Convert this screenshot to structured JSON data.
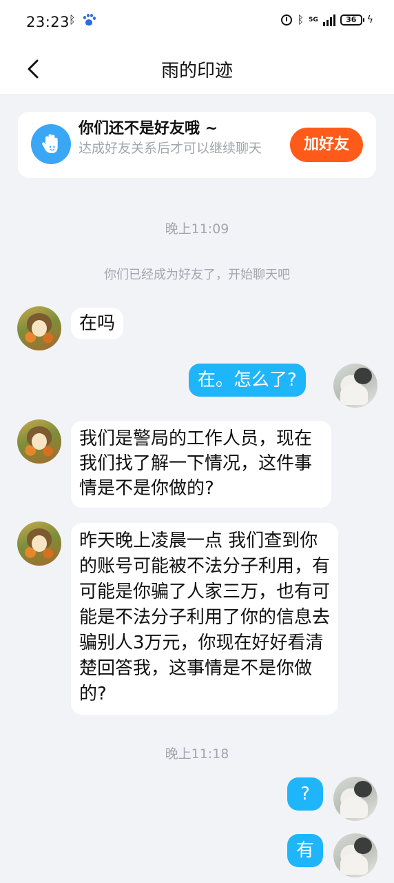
{
  "status_bar": {
    "time": "23:23",
    "network": "5G",
    "battery": "36"
  },
  "header": {
    "title": "雨的印迹"
  },
  "friend_notice": {
    "title": "你们还不是好友哦 ~",
    "description": "达成好友关系后才可以继续聊天",
    "add_button": "加好友"
  },
  "chat": {
    "timestamp_1": "晚上11:09",
    "system_note": "你们已经成为好友了，开始聊天吧",
    "msg_1": "在吗",
    "msg_2": "在。怎么了?",
    "msg_3": "我们是警局的工作人员，现在我们找了解一下情况，这件事情是不是你做的?",
    "msg_4": "昨天晚上凌晨一点 我们查到你的账号可能被不法分子利用，有可能是你骗了人家三万，也有可能是不法分子利用了你的信息去骗别人3万元，你现在好好看清楚回答我，这事情是不是你做的?",
    "timestamp_2": "晚上11:18",
    "msg_5": "?",
    "msg_6": "有"
  },
  "colors": {
    "accent_blue": "#1fb5fb",
    "add_friend_orange": "#fe5b1b",
    "background": "#f2f3f7"
  },
  "icons": [
    "bluetooth-icon",
    "baidu-paw-icon",
    "alarm-icon",
    "signal-icon",
    "battery-icon",
    "charging-icon",
    "back-arrow-icon",
    "hand-wave-icon"
  ]
}
